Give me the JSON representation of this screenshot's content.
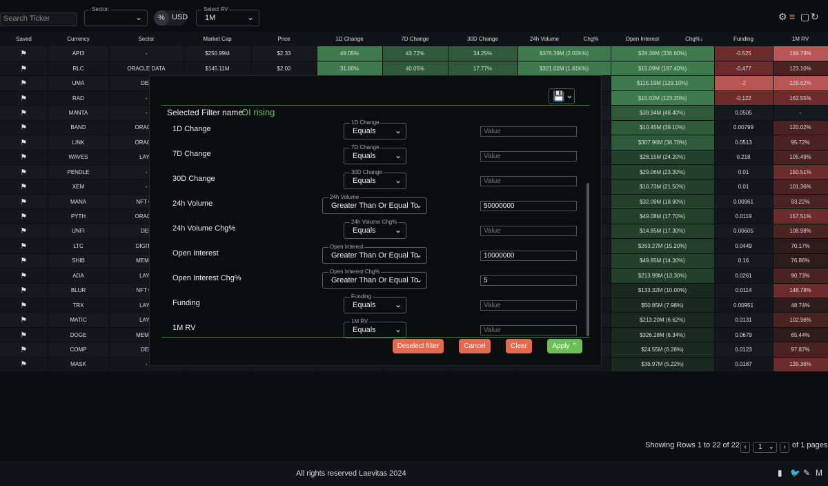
{
  "search": {
    "placeholder": "Search Ticker"
  },
  "sector_filter": {
    "label": "Sector:",
    "value": ""
  },
  "currency_toggle": {
    "percent": "%",
    "usd": "USD"
  },
  "rv_select": {
    "label": "Select RV",
    "value": "1M"
  },
  "toolbar_icons": {
    "settings": "⚙",
    "filter": "≡",
    "sheet": "▢",
    "refresh": "↻"
  },
  "table": {
    "headers": [
      "Saved",
      "Currency",
      "Sector",
      "Market Cap",
      "Price",
      "1D Change",
      "7D Change",
      "30D Change",
      "24h Volume",
      "Chg%",
      "Open Interest",
      "Chg%↓",
      "Funding",
      "1M RV"
    ],
    "flag_icon": "⚑",
    "rows": [
      {
        "currency": "API3",
        "sector": "-",
        "mcap": "$250.99M",
        "price": "$2.33",
        "d1": "49.05%",
        "d7": "43.72%",
        "d30": "34.25%",
        "vol": "$376.39M (2.02K%)",
        "oi": "$28.36M (336.60%)",
        "funding": "-0.525",
        "rv": "189.79%"
      },
      {
        "currency": "RLC",
        "sector": "ORACLE DATA",
        "mcap": "$145.11M",
        "price": "$2.02",
        "d1": "31.80%",
        "d7": "40.05%",
        "d30": "17.77%",
        "vol": "$321.02M (1.61K%)",
        "oi": "$15.09M (187.40%)",
        "funding": "-0.477",
        "rv": "123.10%"
      },
      {
        "currency": "UMA",
        "sector": "DEF",
        "mcap": "",
        "price": "",
        "d1": "",
        "d7": "",
        "d30": "",
        "vol": "",
        "oi": "$115.19M (129.10%)",
        "funding": "-2",
        "rv": "229.62%"
      },
      {
        "currency": "RAD",
        "sector": "-",
        "mcap": "",
        "price": "",
        "d1": "",
        "d7": "",
        "d30": "",
        "vol": "",
        "oi": "$15.02M (123.20%)",
        "funding": "-0.122",
        "rv": "162.55%"
      },
      {
        "currency": "MANTA",
        "sector": "-",
        "mcap": "",
        "price": "",
        "d1": "",
        "d7": "",
        "d30": "",
        "vol": "",
        "oi": "$39.94M (48.40%)",
        "funding": "0.0505",
        "rv": "-"
      },
      {
        "currency": "BAND",
        "sector": "ORACLE",
        "mcap": "",
        "price": "",
        "d1": "",
        "d7": "",
        "d30": "",
        "vol": "",
        "oi": "$10.45M (39.10%)",
        "funding": "0.00799",
        "rv": "120.02%"
      },
      {
        "currency": "LINK",
        "sector": "ORACLE",
        "mcap": "",
        "price": "",
        "d1": "",
        "d7": "",
        "d30": "",
        "vol": "",
        "oi": "$307.96M (38.70%)",
        "funding": "0.0513",
        "rv": "95.72%"
      },
      {
        "currency": "WAVES",
        "sector": "LAYE",
        "mcap": "",
        "price": "",
        "d1": "",
        "d7": "",
        "d30": "",
        "vol": "",
        "oi": "$28.15M (24.20%)",
        "funding": "0.218",
        "rv": "105.49%"
      },
      {
        "currency": "PENDLE",
        "sector": "-",
        "mcap": "",
        "price": "",
        "d1": "",
        "d7": "",
        "d30": "",
        "vol": "",
        "oi": "$29.06M (23.30%)",
        "funding": "0.01",
        "rv": "150.51%"
      },
      {
        "currency": "XEM",
        "sector": "-",
        "mcap": "",
        "price": "",
        "d1": "",
        "d7": "",
        "d30": "",
        "vol": "",
        "oi": "$10.73M (21.50%)",
        "funding": "0.01",
        "rv": "101.36%"
      },
      {
        "currency": "MANA",
        "sector": "NFT GA",
        "mcap": "",
        "price": "",
        "d1": "",
        "d7": "",
        "d30": "",
        "vol": "",
        "oi": "$32.09M (18.90%)",
        "funding": "0.00961",
        "rv": "93.22%"
      },
      {
        "currency": "PYTH",
        "sector": "ORACLE",
        "mcap": "",
        "price": "",
        "d1": "",
        "d7": "",
        "d30": "",
        "vol": "",
        "oi": "$49.08M (17.70%)",
        "funding": "0.0119",
        "rv": "157.51%"
      },
      {
        "currency": "UNFI",
        "sector": "DEF",
        "mcap": "",
        "price": "",
        "d1": "",
        "d7": "",
        "d30": "",
        "vol": "",
        "oi": "$14.85M (17.30%)",
        "funding": "0.00605",
        "rv": "108.98%"
      },
      {
        "currency": "LTC",
        "sector": "DIGITAL",
        "mcap": "",
        "price": "",
        "d1": "",
        "d7": "",
        "d30": "",
        "vol": "",
        "oi": "$263.27M (15.20%)",
        "funding": "0.0449",
        "rv": "70.17%"
      },
      {
        "currency": "SHIB",
        "sector": "MEMEC",
        "mcap": "",
        "price": "",
        "d1": "",
        "d7": "",
        "d30": "",
        "vol": "",
        "oi": "$49.85M (14.30%)",
        "funding": "0.16",
        "rv": "76.86%"
      },
      {
        "currency": "ADA",
        "sector": "LAYE",
        "mcap": "",
        "price": "",
        "d1": "",
        "d7": "",
        "d30": "",
        "vol": "",
        "oi": "$213.99M (13.30%)",
        "funding": "0.0261",
        "rv": "90.73%"
      },
      {
        "currency": "BLUR",
        "sector": "NFT GA",
        "mcap": "",
        "price": "",
        "d1": "",
        "d7": "",
        "d30": "",
        "vol": "",
        "oi": "$133.32M (10.00%)",
        "funding": "0.0114",
        "rv": "148.78%"
      },
      {
        "currency": "TRX",
        "sector": "LAYE",
        "mcap": "",
        "price": "",
        "d1": "",
        "d7": "",
        "d30": "",
        "vol": "",
        "oi": "$50.85M (7.98%)",
        "funding": "0.00951",
        "rv": "48.74%"
      },
      {
        "currency": "MATIC",
        "sector": "LAYE",
        "mcap": "",
        "price": "",
        "d1": "",
        "d7": "",
        "d30": "",
        "vol": "",
        "oi": "$213.20M (6.62%)",
        "funding": "0.0131",
        "rv": "102.96%"
      },
      {
        "currency": "DOGE",
        "sector": "MEMEC",
        "mcap": "",
        "price": "",
        "d1": "",
        "d7": "",
        "d30": "",
        "vol": "",
        "oi": "$326.28M (6.34%)",
        "funding": "0.0679",
        "rv": "65.44%"
      },
      {
        "currency": "COMP",
        "sector": "DEF",
        "mcap": "",
        "price": "",
        "d1": "",
        "d7": "",
        "d30": "",
        "vol": "",
        "oi": "$24.55M (6.28%)",
        "funding": "0.0123",
        "rv": "97.87%"
      },
      {
        "currency": "MASK",
        "sector": "-",
        "mcap": "",
        "price": "",
        "d1": "",
        "d7": "",
        "d30": "",
        "vol": "",
        "oi": "$36.97M (5.22%)",
        "funding": "0.0187",
        "rv": "139.36%"
      }
    ]
  },
  "modal": {
    "save_icon": "💾",
    "chevron": "⌄",
    "selected_label": "Selected Filter name:",
    "selected_value": "OI rising",
    "filters": [
      {
        "name": "1D Change",
        "legend": "1D Change",
        "op": "Equals",
        "value": "",
        "placeholder": "Value"
      },
      {
        "name": "7D Change",
        "legend": "7D Change",
        "op": "Equals",
        "value": "",
        "placeholder": "Value"
      },
      {
        "name": "30D Change",
        "legend": "30D Change",
        "op": "Equals",
        "value": "",
        "placeholder": "Value"
      },
      {
        "name": "24h Volume",
        "legend": "24h Volume",
        "op": "Greater Than Or Equal To",
        "value": "50000000",
        "placeholder": "Value"
      },
      {
        "name": "24h Volume Chg%",
        "legend": "24h Volume Chg%",
        "op": "Equals",
        "value": "",
        "placeholder": "Value"
      },
      {
        "name": "Open Interest",
        "legend": "Open Interest",
        "op": "Greater Than Or Equal To",
        "value": "10000000",
        "placeholder": "Value"
      },
      {
        "name": "Open Interest Chg%",
        "legend": "Open Interest Chg%",
        "op": "Greater Than Or Equal To",
        "value": "5",
        "placeholder": "Value"
      },
      {
        "name": "Funding",
        "legend": "Funding",
        "op": "Equals",
        "value": "",
        "placeholder": "Value"
      },
      {
        "name": "1M RV",
        "legend": "1M RV",
        "op": "Equals",
        "value": "",
        "placeholder": "Value"
      }
    ],
    "buttons": {
      "deselect": "Deselect filter",
      "cancel": "Cancel",
      "clear": "Clear",
      "apply": "Apply ⌃"
    }
  },
  "pagination": {
    "showing": "Showing Rows 1 to 22 of 22",
    "prev": "‹",
    "page": "1",
    "next": "›",
    "of": "of 1 pages"
  },
  "footer": {
    "text": "All rights reserved Laevitas 2024",
    "icons": [
      "▮",
      "🐦",
      "✎",
      "M"
    ]
  },
  "colors": {
    "accent_green": "#6fbf6f",
    "deselect": "#e46a4f",
    "cancel": "#e46a4f",
    "clear": "#e46a4f",
    "apply": "#6dbf55"
  }
}
